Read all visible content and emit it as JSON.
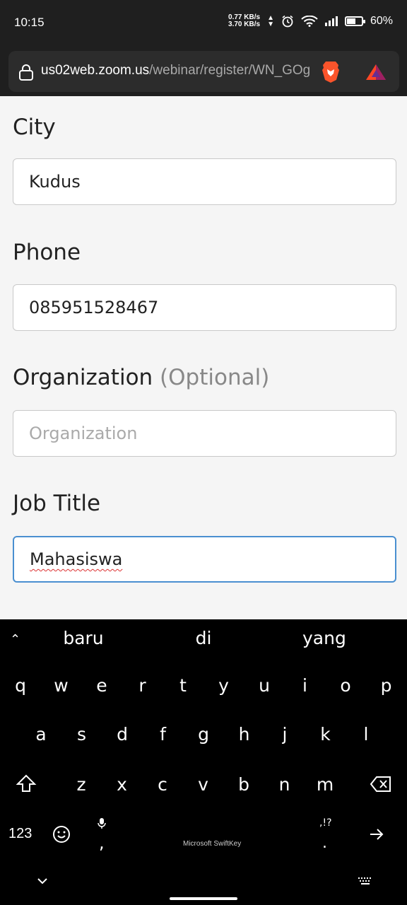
{
  "status_bar": {
    "time": "10:15",
    "speed_up": "0.77 KB/s",
    "speed_down": "3.70 KB/s",
    "battery_pct": "60%",
    "battery_level": 0.6
  },
  "browser": {
    "url_host": "us02web.zoom.us",
    "url_path": "/webinar/register/WN_GOg"
  },
  "form": {
    "city": {
      "label": "City",
      "value": "Kudus"
    },
    "phone": {
      "label": "Phone",
      "value": "085951528467"
    },
    "organization": {
      "label": "Organization",
      "optional": "(Optional)",
      "placeholder": "Organization"
    },
    "job_title": {
      "label": "Job Title",
      "value": "Mahasiswa"
    }
  },
  "keyboard": {
    "suggestions": [
      "baru",
      "di",
      "yang"
    ],
    "row1": [
      "q",
      "w",
      "e",
      "r",
      "t",
      "y",
      "u",
      "i",
      "o",
      "p"
    ],
    "row2": [
      "a",
      "s",
      "d",
      "f",
      "g",
      "h",
      "j",
      "k",
      "l"
    ],
    "row3": [
      "z",
      "x",
      "c",
      "v",
      "b",
      "n",
      "m"
    ],
    "num_key": "123",
    "brand": "Microsoft SwiftKey",
    "punct_hint": ",!?",
    "period": ".",
    "comma": ","
  }
}
